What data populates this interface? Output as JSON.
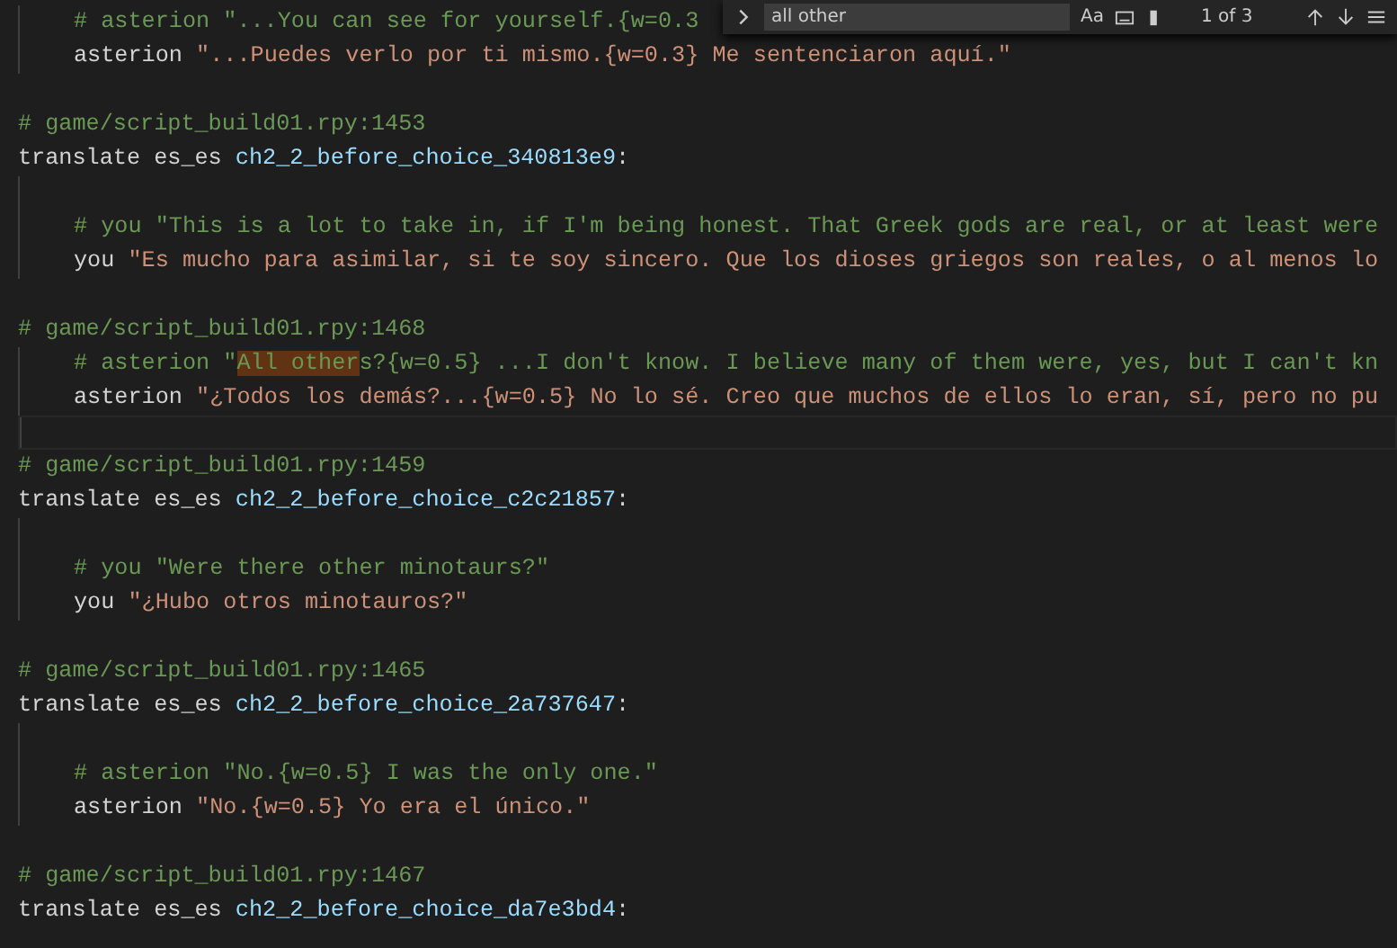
{
  "find_widget": {
    "query": "all other",
    "match_case": "Aa",
    "match_count": "1 of 3"
  },
  "lines": [
    {
      "kind": "code",
      "indent": true,
      "segments": [
        {
          "kind": "comment",
          "text": "# asterion \"...You can see for yourself.{w=0.3"
        }
      ]
    },
    {
      "kind": "code",
      "indent": true,
      "segments": [
        {
          "kind": "plain",
          "text": "asterion "
        },
        {
          "kind": "string",
          "text": "\"...Puedes verlo por ti mismo.{w=0.3} Me sentenciaron aquí.\""
        }
      ]
    },
    {
      "kind": "blank",
      "indent": false
    },
    {
      "kind": "code",
      "indent": false,
      "segments": [
        {
          "kind": "comment",
          "text": "# game/script_build01.rpy:1453"
        }
      ]
    },
    {
      "kind": "code",
      "indent": false,
      "segments": [
        {
          "kind": "plain",
          "text": "translate es_es "
        },
        {
          "kind": "label",
          "text": "ch2_2_before_choice_340813e9"
        },
        {
          "kind": "plain",
          "text": ":"
        }
      ]
    },
    {
      "kind": "blank",
      "indent": true
    },
    {
      "kind": "code",
      "indent": true,
      "segments": [
        {
          "kind": "comment",
          "text": "# you \"This is a lot to take in, if I'm being honest. That Greek gods are real, or at least were"
        }
      ]
    },
    {
      "kind": "code",
      "indent": true,
      "segments": [
        {
          "kind": "plain",
          "text": "you "
        },
        {
          "kind": "string",
          "text": "\"Es mucho para asimilar, si te soy sincero. Que los dioses griegos son reales, o al menos lo"
        }
      ]
    },
    {
      "kind": "blank",
      "indent": false
    },
    {
      "kind": "code",
      "indent": false,
      "segments": [
        {
          "kind": "comment",
          "text": "# game/script_build01.rpy:1468"
        }
      ]
    },
    {
      "kind": "code",
      "indent": true,
      "segments": [
        {
          "kind": "comment",
          "text": "# asterion \""
        },
        {
          "kind": "match",
          "text": "All other"
        },
        {
          "kind": "comment",
          "text": "s?{w=0.5} ...I don't know. I believe many of them were, yes, but I can't kn"
        }
      ]
    },
    {
      "kind": "code",
      "indent": true,
      "segments": [
        {
          "kind": "plain",
          "text": "asterion "
        },
        {
          "kind": "string",
          "text": "\"¿Todos los demás?...{w=0.5} No lo sé. Creo que muchos de ellos lo eran, sí, pero no pu"
        }
      ]
    },
    {
      "kind": "blank",
      "indent": true,
      "current": true
    },
    {
      "kind": "code",
      "indent": false,
      "segments": [
        {
          "kind": "comment",
          "text": "# game/script_build01.rpy:1459"
        }
      ]
    },
    {
      "kind": "code",
      "indent": false,
      "segments": [
        {
          "kind": "plain",
          "text": "translate es_es "
        },
        {
          "kind": "label",
          "text": "ch2_2_before_choice_c2c21857"
        },
        {
          "kind": "plain",
          "text": ":"
        }
      ]
    },
    {
      "kind": "blank",
      "indent": true
    },
    {
      "kind": "code",
      "indent": true,
      "segments": [
        {
          "kind": "comment",
          "text": "# you \"Were there other minotaurs?\""
        }
      ]
    },
    {
      "kind": "code",
      "indent": true,
      "segments": [
        {
          "kind": "plain",
          "text": "you "
        },
        {
          "kind": "string",
          "text": "\"¿Hubo otros minotauros?\""
        }
      ]
    },
    {
      "kind": "blank",
      "indent": false
    },
    {
      "kind": "code",
      "indent": false,
      "segments": [
        {
          "kind": "comment",
          "text": "# game/script_build01.rpy:1465"
        }
      ]
    },
    {
      "kind": "code",
      "indent": false,
      "segments": [
        {
          "kind": "plain",
          "text": "translate es_es "
        },
        {
          "kind": "label",
          "text": "ch2_2_before_choice_2a737647"
        },
        {
          "kind": "plain",
          "text": ":"
        }
      ]
    },
    {
      "kind": "blank",
      "indent": true
    },
    {
      "kind": "code",
      "indent": true,
      "segments": [
        {
          "kind": "comment",
          "text": "# asterion \"No.{w=0.5} I was the only one.\""
        }
      ]
    },
    {
      "kind": "code",
      "indent": true,
      "segments": [
        {
          "kind": "plain",
          "text": "asterion "
        },
        {
          "kind": "string",
          "text": "\"No.{w=0.5} Yo era el único.\""
        }
      ]
    },
    {
      "kind": "blank",
      "indent": false
    },
    {
      "kind": "code",
      "indent": false,
      "segments": [
        {
          "kind": "comment",
          "text": "# game/script_build01.rpy:1467"
        }
      ]
    },
    {
      "kind": "code",
      "indent": false,
      "segments": [
        {
          "kind": "plain",
          "text": "translate es_es "
        },
        {
          "kind": "label",
          "text": "ch2_2_before_choice_da7e3bd4"
        },
        {
          "kind": "plain",
          "text": ":"
        }
      ]
    }
  ]
}
